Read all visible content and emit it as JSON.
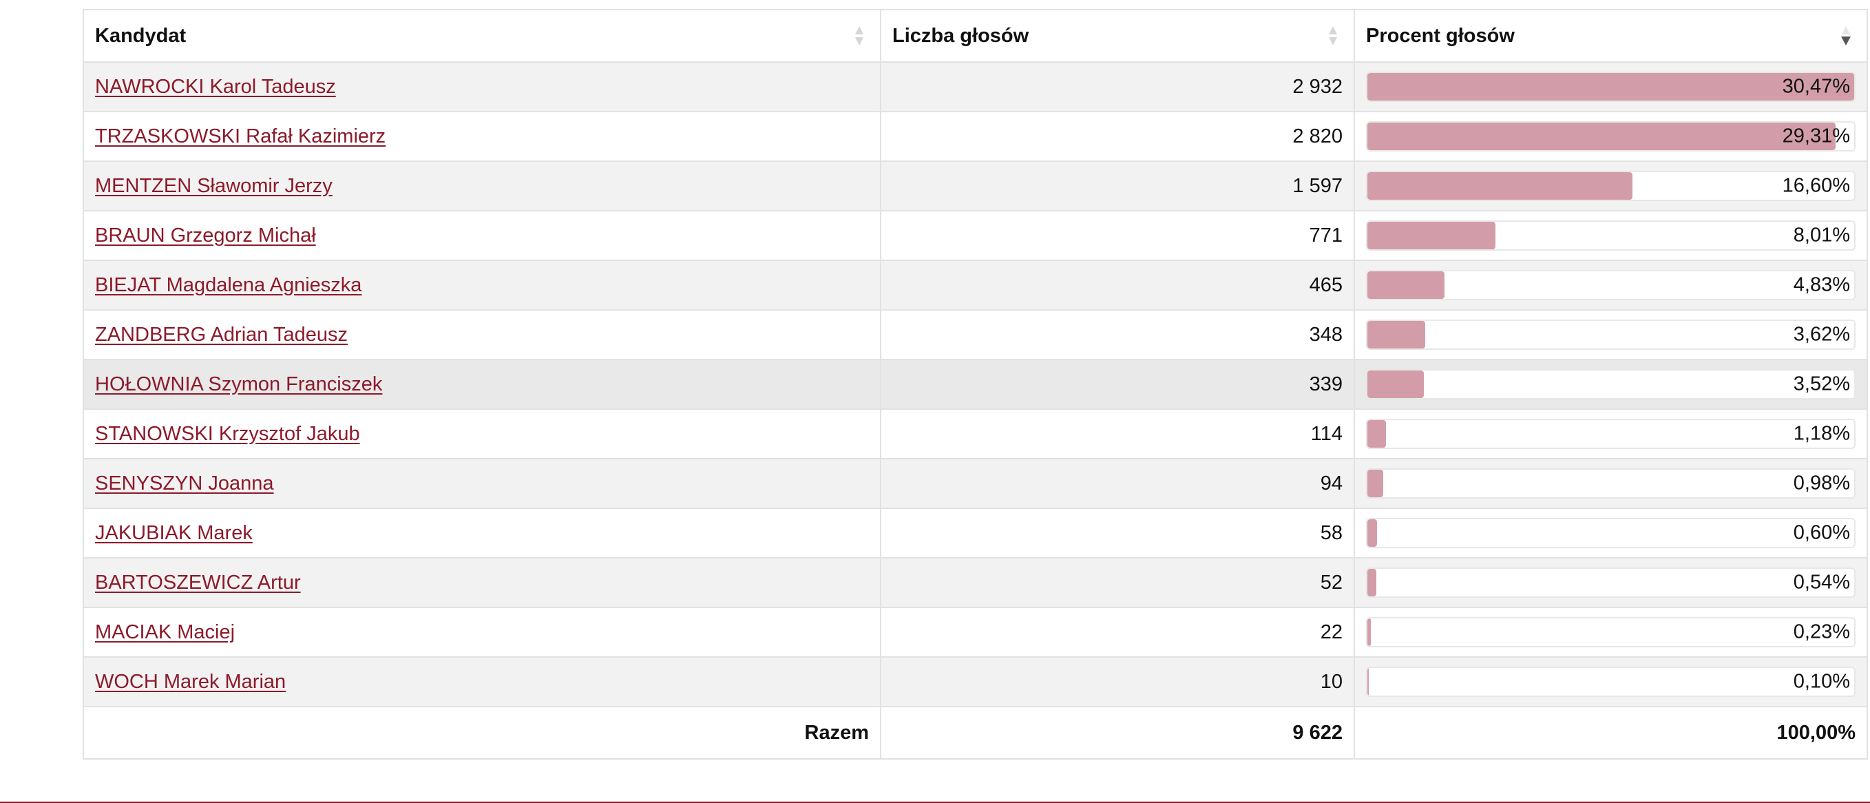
{
  "table": {
    "headers": {
      "candidate": "Kandydat",
      "votes": "Liczba głosów",
      "percent": "Procent głosów"
    },
    "rows": [
      {
        "name": "NAWROCKI Karol Tadeusz",
        "votes": "2 932",
        "percent": "30,47%",
        "share": 30.47
      },
      {
        "name": "TRZASKOWSKI Rafał Kazimierz",
        "votes": "2 820",
        "percent": "29,31%",
        "share": 29.31
      },
      {
        "name": "MENTZEN Sławomir Jerzy",
        "votes": "1 597",
        "percent": "16,60%",
        "share": 16.6
      },
      {
        "name": "BRAUN Grzegorz Michał",
        "votes": "771",
        "percent": "8,01%",
        "share": 8.01
      },
      {
        "name": "BIEJAT Magdalena Agnieszka",
        "votes": "465",
        "percent": "4,83%",
        "share": 4.83
      },
      {
        "name": "ZANDBERG Adrian Tadeusz",
        "votes": "348",
        "percent": "3,62%",
        "share": 3.62
      },
      {
        "name": "HOŁOWNIA Szymon Franciszek",
        "votes": "339",
        "percent": "3,52%",
        "share": 3.52
      },
      {
        "name": "STANOWSKI Krzysztof Jakub",
        "votes": "114",
        "percent": "1,18%",
        "share": 1.18
      },
      {
        "name": "SENYSZYN Joanna",
        "votes": "94",
        "percent": "0,98%",
        "share": 0.98
      },
      {
        "name": "JAKUBIAK Marek",
        "votes": "58",
        "percent": "0,60%",
        "share": 0.6
      },
      {
        "name": "BARTOSZEWICZ Artur",
        "votes": "52",
        "percent": "0,54%",
        "share": 0.54
      },
      {
        "name": "MACIAK Maciej",
        "votes": "22",
        "percent": "0,23%",
        "share": 0.23
      },
      {
        "name": "WOCH Marek Marian",
        "votes": "10",
        "percent": "0,10%",
        "share": 0.1
      }
    ],
    "footer": {
      "label": "Razem",
      "votes": "9 622",
      "percent": "100,00%"
    }
  },
  "sort": {
    "candidate": "unsorted-icon",
    "votes": "unsorted-icon",
    "percent": "sort-descending-icon"
  },
  "colors": {
    "link": "#8c1a2a",
    "bar": "#d29da8",
    "row_alt": "#f2f2f2"
  }
}
